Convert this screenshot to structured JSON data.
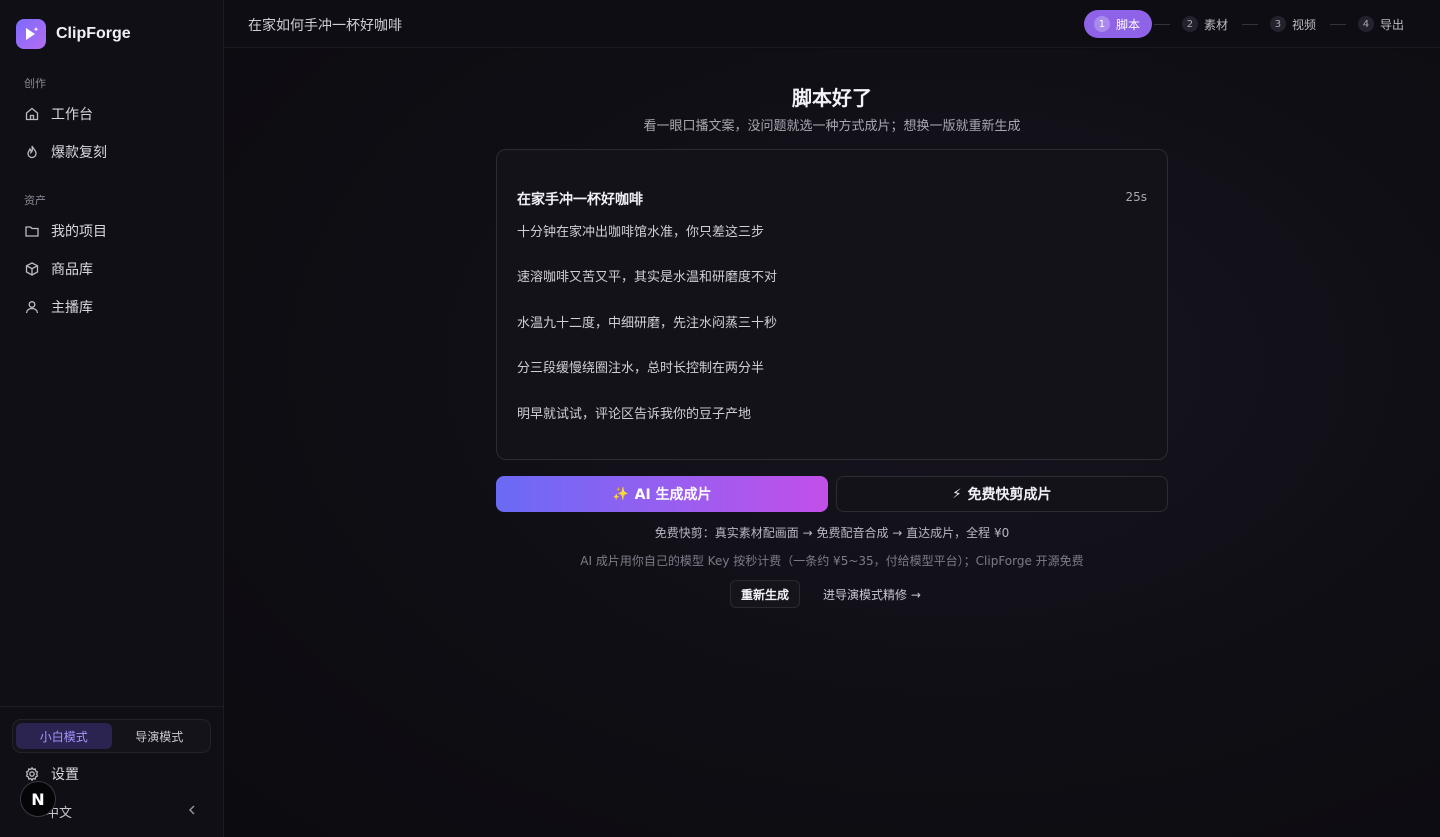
{
  "app": {
    "name": "ClipForge",
    "logo_icon": "sparkle-play-icon"
  },
  "sidebar": {
    "sections": [
      {
        "label": "创作",
        "items": [
          {
            "label": "工作台",
            "icon": "home-icon"
          },
          {
            "label": "爆款复刻",
            "icon": "flame-icon"
          }
        ]
      },
      {
        "label": "资产",
        "items": [
          {
            "label": "我的项目",
            "icon": "folder-icon"
          },
          {
            "label": "商品库",
            "icon": "box-icon"
          },
          {
            "label": "主播库",
            "icon": "user-icon"
          }
        ]
      }
    ],
    "modes": [
      {
        "label": "小白模式",
        "active": true
      },
      {
        "label": "导演模式",
        "active": false
      }
    ],
    "settings_label": "设置",
    "language_label": "中文",
    "badge_letter": "N"
  },
  "topbar": {
    "project_title": "在家如何手冲一杯好咖啡",
    "steps": [
      {
        "num": "1",
        "label": "脚本",
        "active": true
      },
      {
        "num": "2",
        "label": "素材",
        "active": false
      },
      {
        "num": "3",
        "label": "视频",
        "active": false
      },
      {
        "num": "4",
        "label": "导出",
        "active": false
      }
    ]
  },
  "main": {
    "heading": "脚本好了",
    "subheading": "看一眼口播文案，没问题就选一种方式成片；想换一版就重新生成",
    "script": {
      "title": "在家手冲一杯好咖啡",
      "duration": "25s",
      "lines": [
        "十分钟在家冲出咖啡馆水准，你只差这三步",
        "速溶咖啡又苦又平，其实是水温和研磨度不对",
        "水温九十二度，中细研磨，先注水闷蒸三十秒",
        "分三段缓慢绕圈注水，总时长控制在两分半",
        "明早就试试，评论区告诉我你的豆子产地"
      ]
    },
    "ai_button": {
      "icon": "✨",
      "label": "AI 生成成片"
    },
    "quick_button": {
      "icon": "⚡",
      "label": "免费快剪成片"
    },
    "note_quick": "免费快剪：真实素材配画面 → 免费配音合成 → 直达成片，全程 ¥0",
    "note_ai": "AI 成片用你自己的模型 Key 按秒计费（一条约 ¥5~35，付给模型平台）；ClipForge 开源免费",
    "regenerate_label": "重新生成",
    "director_link": "进导演模式精修 →"
  },
  "colors": {
    "accent": "#8f63e8",
    "gradient_start": "#6a6af5",
    "gradient_end": "#c24fe8"
  }
}
